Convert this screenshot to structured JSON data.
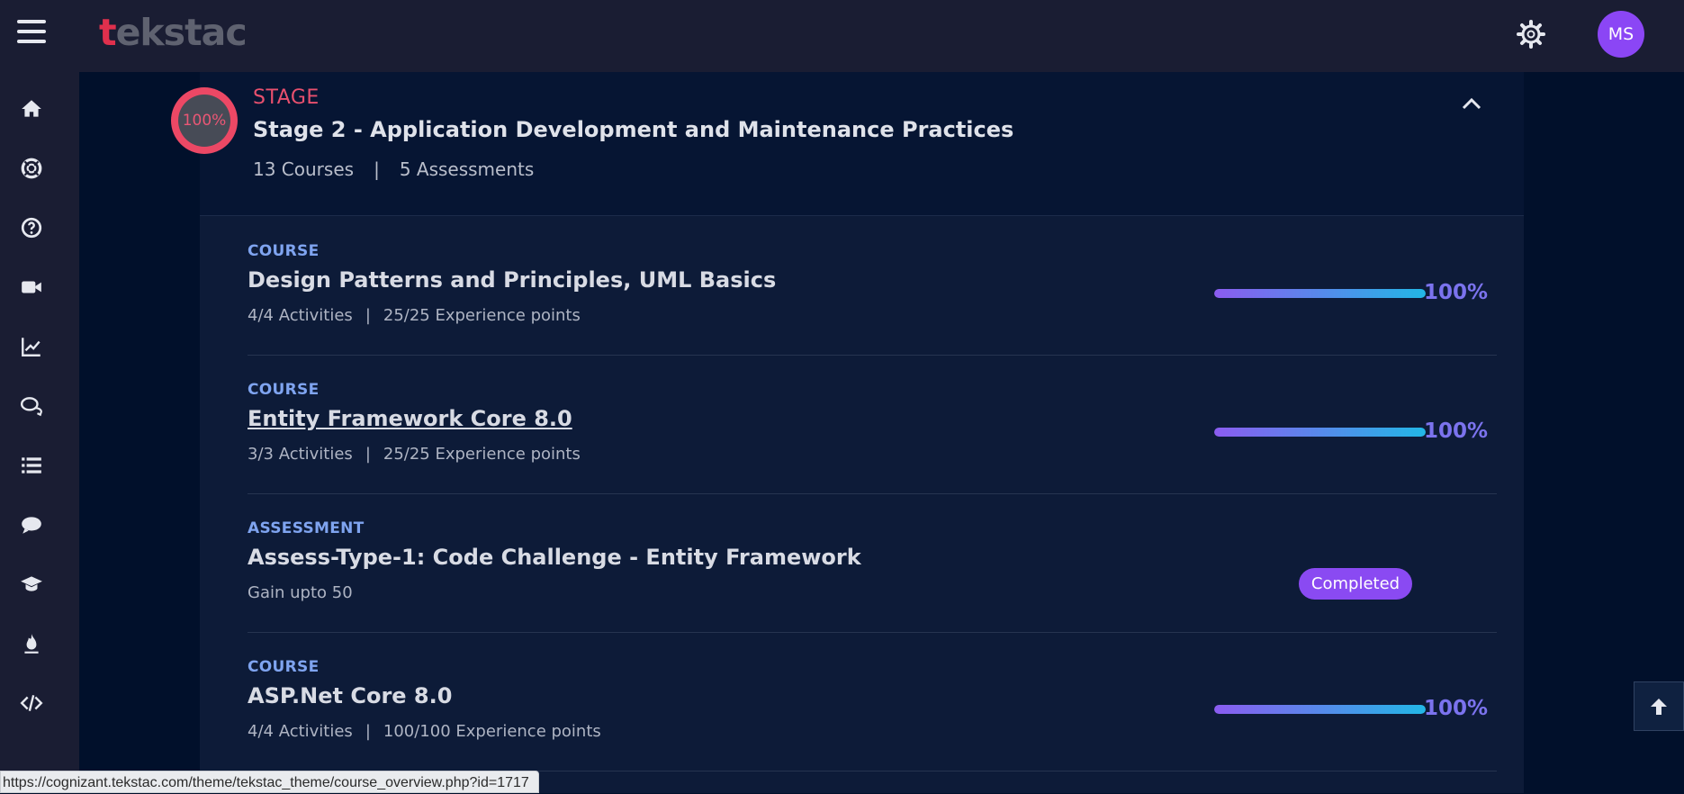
{
  "header": {
    "logo_text": "tekstac",
    "avatar_initials": "MS",
    "menu_icon": "hamburger-icon",
    "settings_icon": "gear-icon"
  },
  "sidebar": {
    "items": [
      {
        "icon": "home-icon"
      },
      {
        "icon": "lifebuoy-icon"
      },
      {
        "icon": "help-circle-icon"
      },
      {
        "icon": "video-camera-icon"
      },
      {
        "icon": "line-chart-icon"
      },
      {
        "icon": "chat-bubbles-icon"
      },
      {
        "icon": "list-icon"
      },
      {
        "icon": "comment-icon"
      },
      {
        "icon": "graduation-cap-icon"
      },
      {
        "icon": "fire-icon"
      },
      {
        "icon": "code-icon"
      }
    ]
  },
  "stage": {
    "progress_label": "100%",
    "label": "STAGE",
    "title": "Stage 2 - Application Development and Maintenance Practices",
    "courses": "13 Courses",
    "separator": "|",
    "assessments": "5 Assessments"
  },
  "items": [
    {
      "type": "COURSE",
      "title": "Design Patterns and Principles, UML Basics",
      "activities": "4/4  Activities",
      "sep": "|",
      "xp": "25/25  Experience points",
      "progress_pct": 100,
      "progress_label": "100%"
    },
    {
      "type": "COURSE",
      "title": "Entity Framework Core 8.0",
      "activities": "3/3  Activities",
      "sep": "|",
      "xp": "25/25  Experience points",
      "progress_pct": 100,
      "progress_label": "100%"
    },
    {
      "type": "ASSESSMENT",
      "title": "Assess-Type-1: Code Challenge - Entity Framework",
      "meta": "Gain upto 50",
      "status": "Completed"
    },
    {
      "type": "COURSE",
      "title": "ASP.Net Core 8.0",
      "activities": "4/4  Activities",
      "sep": "|",
      "xp": "100/100  Experience points",
      "progress_pct": 100,
      "progress_label": "100%"
    }
  ],
  "status_bar": {
    "url": "https://cognizant.tekstac.com/theme/tekstac_theme/course_overview.php?id=1717"
  },
  "colors": {
    "accent_pink": "#e8506e",
    "accent_purple": "#8a4af2",
    "progress_start": "#8b5cf0",
    "progress_end": "#22b7e6"
  }
}
